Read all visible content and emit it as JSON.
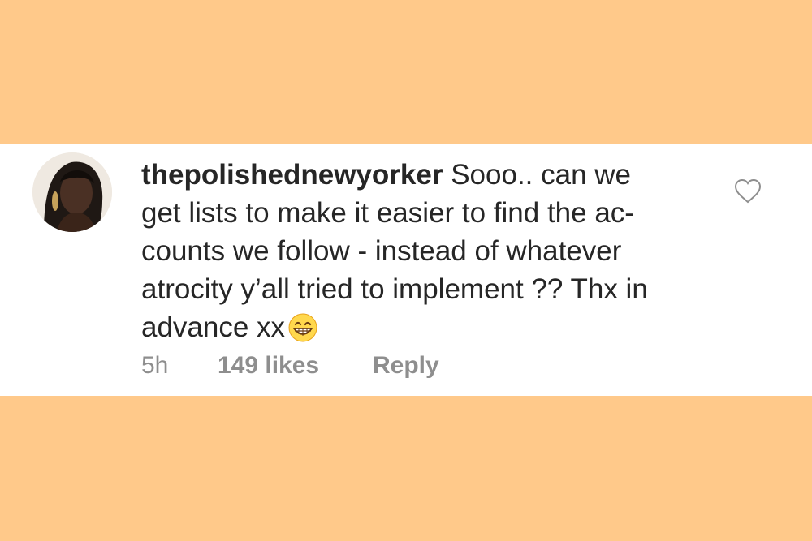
{
  "comment": {
    "username": "thepolishednewyorker",
    "text_lines": [
      " Sooo.. can we",
      "get lists to make it easier to find the ac-",
      "counts we follow - instead of whatever",
      "atrocity y’all tried to implement ?? Thx in",
      "advance xx"
    ],
    "emoji": "grinning-face-with-smiling-eyes",
    "time": "5h",
    "likes": "149 likes",
    "reply_label": "Reply"
  },
  "icons": {
    "like": "heart-outline-icon"
  },
  "colors": {
    "background": "#FFC98A",
    "card": "#FFFFFF",
    "text": "#262626",
    "meta_text": "#8E8E8E"
  }
}
